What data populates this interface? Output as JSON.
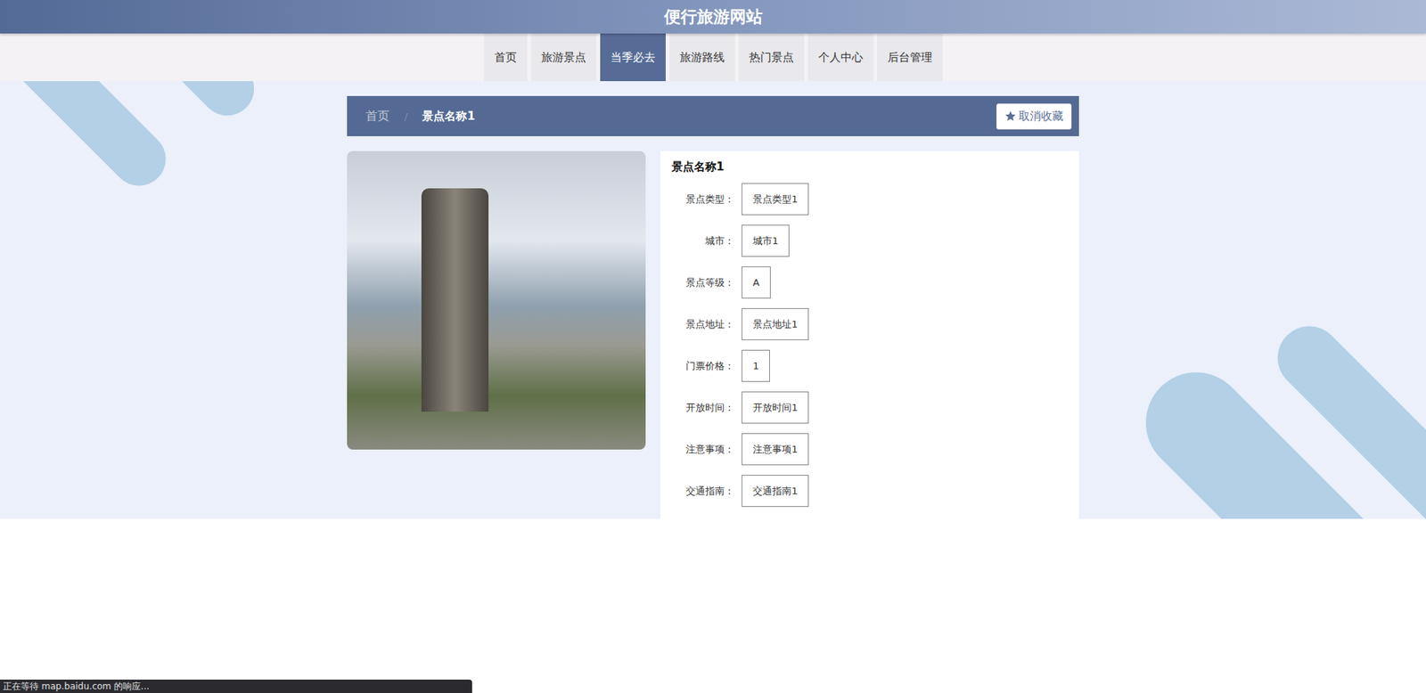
{
  "window": {
    "title": "便行旅游网站"
  },
  "nav": [
    {
      "label": "首页",
      "selected": false
    },
    {
      "label": "旅游景点",
      "selected": false
    },
    {
      "label": "当季必去",
      "selected": true
    },
    {
      "label": "旅游路线",
      "selected": false
    },
    {
      "label": "热门景点",
      "selected": false
    },
    {
      "label": "个人中心",
      "selected": false
    },
    {
      "label": "后台管理",
      "selected": false
    }
  ],
  "breadcrumb": {
    "home": "首页",
    "separator": "/",
    "current": "景点名称1"
  },
  "favorite_button": {
    "label": "取消收藏"
  },
  "detail": {
    "name": "景点名称1",
    "fields": [
      {
        "label": "景点类型：",
        "value": "景点类型1"
      },
      {
        "label": "城市：",
        "value": "城市1"
      },
      {
        "label": "景点等级：",
        "value": "A"
      },
      {
        "label": "景点地址：",
        "value": "景点地址1"
      },
      {
        "label": "门票价格：",
        "value": "1"
      },
      {
        "label": "开放时间：",
        "value": "开放时间1"
      },
      {
        "label": "注意事项：",
        "value": "注意事项1"
      },
      {
        "label": "交通指南：",
        "value": "交通指南1"
      }
    ]
  },
  "status_bar": "正在等待 map.baidu.com 的响应..."
}
